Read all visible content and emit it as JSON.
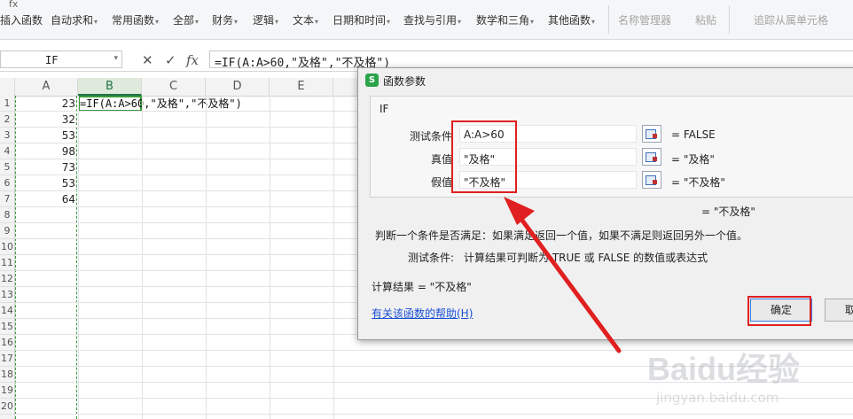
{
  "ribbon": {
    "top_label": "fx",
    "items": [
      {
        "label": "插入函数",
        "arrow": "",
        "disabled": false
      },
      {
        "label": "自动求和",
        "arrow": "▾",
        "disabled": false
      },
      {
        "label": "常用函数",
        "arrow": "▾",
        "disabled": false
      },
      {
        "label": "全部",
        "arrow": "▾",
        "disabled": false
      },
      {
        "label": "财务",
        "arrow": "▾",
        "disabled": false
      },
      {
        "label": "逻辑",
        "arrow": "▾",
        "disabled": false
      },
      {
        "label": "文本",
        "arrow": "▾",
        "disabled": false
      },
      {
        "label": "日期和时间",
        "arrow": "▾",
        "disabled": false
      },
      {
        "label": "查找与引用",
        "arrow": "▾",
        "disabled": false
      },
      {
        "label": "数学和三角",
        "arrow": "▾",
        "disabled": false
      },
      {
        "label": "其他函数",
        "arrow": "▾",
        "disabled": false
      },
      {
        "label": "名称管理器",
        "arrow": "",
        "disabled": true
      },
      {
        "label": "粘贴",
        "arrow": "",
        "disabled": true
      },
      {
        "label": "追踪从属单元格",
        "arrow": "",
        "disabled": true
      }
    ]
  },
  "formula_bar": {
    "name_box": "IF",
    "cancel_icon": "✕",
    "confirm_icon": "✓",
    "fx_icon": "fx",
    "formula": "=IF(A:A>60,\"及格\",\"不及格\")"
  },
  "sheet": {
    "columns": [
      "A",
      "B",
      "C",
      "D",
      "E"
    ],
    "active_column": "B",
    "rows": [
      "1",
      "2",
      "3",
      "4",
      "5",
      "6",
      "7",
      "8",
      "9",
      "10",
      "11",
      "12",
      "13",
      "14",
      "15",
      "16",
      "17",
      "18",
      "19",
      "20"
    ],
    "column_a_values": [
      "23",
      "32",
      "53",
      "98",
      "73",
      "53",
      "64"
    ],
    "b1_text": "=IF(A:A>60,\"及格\",\"不及格\")"
  },
  "dialog": {
    "title": "函数参数",
    "icon_letter": "S",
    "function_name": "IF",
    "args": [
      {
        "label": "测试条件",
        "value": "A:A>60",
        "result": "= FALSE"
      },
      {
        "label": "真值",
        "value": "\"及格\"",
        "result": "= \"及格\""
      },
      {
        "label": "假值",
        "value": "\"不及格\"",
        "result": "= \"不及格\""
      }
    ],
    "result_line": "= \"不及格\"",
    "description": "判断一个条件是否满足：如果满足返回一个值，如果不满足则返回另外一个值。",
    "arg_desc_label": "测试条件:",
    "arg_desc": "计算结果可判断为 TRUE 或 FALSE 的数值或表达式",
    "calc_result": "计算结果 = \"不及格\"",
    "help_link": "有关该函数的帮助(H)",
    "ok_label": "确定",
    "cancel_label": "取消"
  },
  "watermark": {
    "brand": "Baidu经验",
    "url": "jingyan.baidu.com"
  },
  "colors": {
    "accent_green": "#217346",
    "annotation_red": "#e02020",
    "link_blue": "#1a4fd6"
  }
}
